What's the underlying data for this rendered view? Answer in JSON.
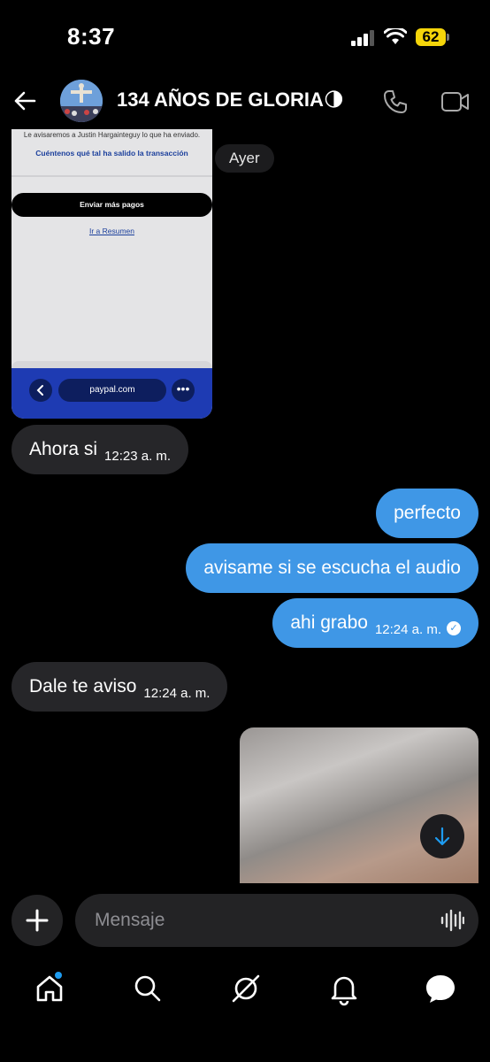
{
  "status_bar": {
    "time": "8:37",
    "battery": "62"
  },
  "header": {
    "title": "134 AÑOS DE GLORIA",
    "title_emoji": "🌗"
  },
  "shared_screenshot": {
    "text_top": "Le avisaremos a Justin Hargainteguy lo que ha enviado.",
    "link_feedback": "Cuéntenos qué tal ha salido la transacción",
    "button": "Enviar más pagos",
    "link_summary": "Ir a Resumen",
    "url": "paypal.com"
  },
  "date_chip": "Ayer",
  "messages": [
    {
      "dir": "in",
      "text": "Ahora si",
      "time": "12:23 a. m."
    },
    {
      "dir": "out",
      "text": "perfecto",
      "time": ""
    },
    {
      "dir": "out",
      "text": "avisame si se escucha el audio",
      "time": ""
    },
    {
      "dir": "out",
      "text": "ahi grabo",
      "time": "12:24 a. m."
    },
    {
      "dir": "in",
      "text": "Dale te aviso",
      "time": "12:24 a. m."
    }
  ],
  "composer": {
    "placeholder": "Mensaje"
  },
  "colors": {
    "outgoing": "#3f97e6",
    "incoming": "#262629",
    "accent": "#1d9bf0"
  },
  "icons": [
    "back-arrow-icon",
    "phone-icon",
    "video-call-icon",
    "plus-icon",
    "voice-wave-icon",
    "scroll-down-icon",
    "home-icon",
    "search-icon",
    "grok-icon",
    "bell-icon",
    "messages-icon"
  ]
}
